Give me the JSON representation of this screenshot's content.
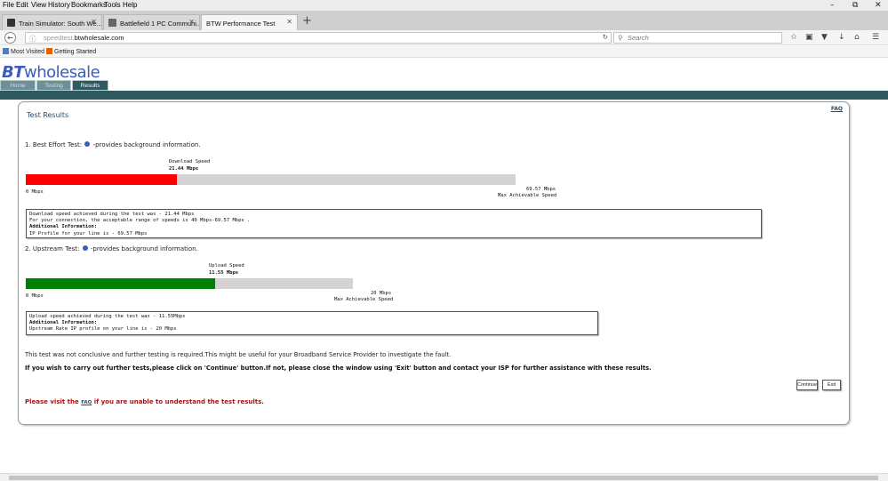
{
  "menu": [
    "File",
    "Edit",
    "View",
    "History",
    "Bookmarks",
    "Tools",
    "Help"
  ],
  "tabs": [
    {
      "title": "Train Simulator: South We..."
    },
    {
      "title": "Battlefield 1 PC Communi..."
    },
    {
      "title": "BTW Performance Test"
    }
  ],
  "url": {
    "prefix": "speedtest.",
    "host": "btwholesale.com"
  },
  "search": {
    "placeholder": "Search"
  },
  "bookmarks": [
    "Most Visited",
    "Getting Started"
  ],
  "logo": {
    "bt": "BT",
    "rest": "wholesale"
  },
  "site_tabs": [
    "Home",
    "Testing",
    "Results"
  ],
  "page": {
    "faq": "FAQ",
    "title": "Test Results",
    "best_effort": {
      "heading_pre": "1. Best Effort Test:",
      "heading_post": "-provides background information.",
      "label": "Download Speed",
      "value": "21.44 Mbps",
      "min": "0 Mbps",
      "max": "69.57 Mbps",
      "max_label": "Max Achievable Speed",
      "fraction": 0.3082,
      "color": "#ff0000",
      "info": [
        "Download speed  achieved during the test was - 21.44 Mbps",
        "For your connection, the acceptable range of speeds  is 40 Mbps-69.57 Mbps .",
        "Additional Information:",
        "IP Profile for your line is - 69.57 Mbps"
      ]
    },
    "upstream": {
      "heading_pre": "2. Upstream Test:",
      "heading_post": "-provides background information.",
      "label": "Upload Speed",
      "value": "11.55 Mbps",
      "min": "0 Mbps",
      "max": "20 Mbps",
      "max_label": "Max Achievable Speed",
      "fraction": 0.5775,
      "color": "#008000",
      "info": [
        "Upload speed  achieved during the test was - 11.55Mbps",
        "Additional Information:",
        "Upstream Rate IP profile on your line is - 20 Mbps"
      ]
    },
    "message1": "This test was not conclusive and further testing is required.This might be useful for your Broadband Service Provider to investigate the fault.",
    "message2": "If you wish to carry out further tests,please click on 'Continue' button.If not, please close the window using 'Exit' button and contact your ISP for further assistance with these results.",
    "continue_label": "Continue",
    "exit_label": "Exit",
    "visit_pre": "Please visit the",
    "visit_link": "FAQ",
    "visit_post": "if you are unable to understand the test results."
  }
}
